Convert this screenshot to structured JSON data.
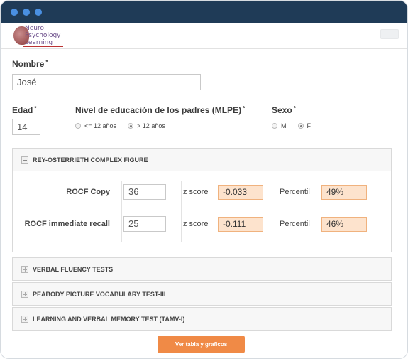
{
  "window": {
    "controls": [
      "dot-1",
      "dot-2",
      "dot-3"
    ]
  },
  "header": {
    "logo_lines": [
      "Neuro",
      "Psychology",
      "Learning"
    ],
    "menu_icon": "menu-icon"
  },
  "form": {
    "nombre": {
      "label": "Nombre",
      "required": "*",
      "value": "José"
    },
    "edad": {
      "label": "Edad",
      "required": "*",
      "value": "14"
    },
    "mlpe": {
      "label": "Nivel de educación de los padres (MLPE)",
      "required": "*",
      "options": [
        "<= 12 años",
        "> 12 años"
      ],
      "selected": "> 12 años"
    },
    "sexo": {
      "label": "Sexo",
      "required": "*",
      "options": [
        "M",
        "F"
      ],
      "selected": "F"
    }
  },
  "panels": {
    "rocf": {
      "title": "REY-OSTERRIETH COMPLEX FIGURE",
      "state": "expanded",
      "rows": [
        {
          "label": "ROCF Copy",
          "value": "36",
          "z_label": "z score",
          "z_value": "-0.033",
          "p_label": "Percentil",
          "p_value": "49%"
        },
        {
          "label": "ROCF immediate recall",
          "value": "25",
          "z_label": "z score",
          "z_value": "-0.111",
          "p_label": "Percentil",
          "p_value": "46%"
        }
      ]
    },
    "collapsed": [
      {
        "title": "VERBAL FLUENCY TESTS",
        "state": "collapsed"
      },
      {
        "title": "PEABODY PICTURE VOCABULARY TEST-III",
        "state": "collapsed"
      },
      {
        "title": "LEARNING AND VERBAL MEMORY TEST (TAMV-I)",
        "state": "collapsed"
      }
    ]
  },
  "actions": {
    "submit_label": "Ver tabla y graficos"
  },
  "colors": {
    "titlebar": "#1f3b57",
    "window_dots": "#4a90e2",
    "accent": "#f08a46",
    "result_fill": "#fde3cd",
    "result_border": "#f0b27e"
  }
}
